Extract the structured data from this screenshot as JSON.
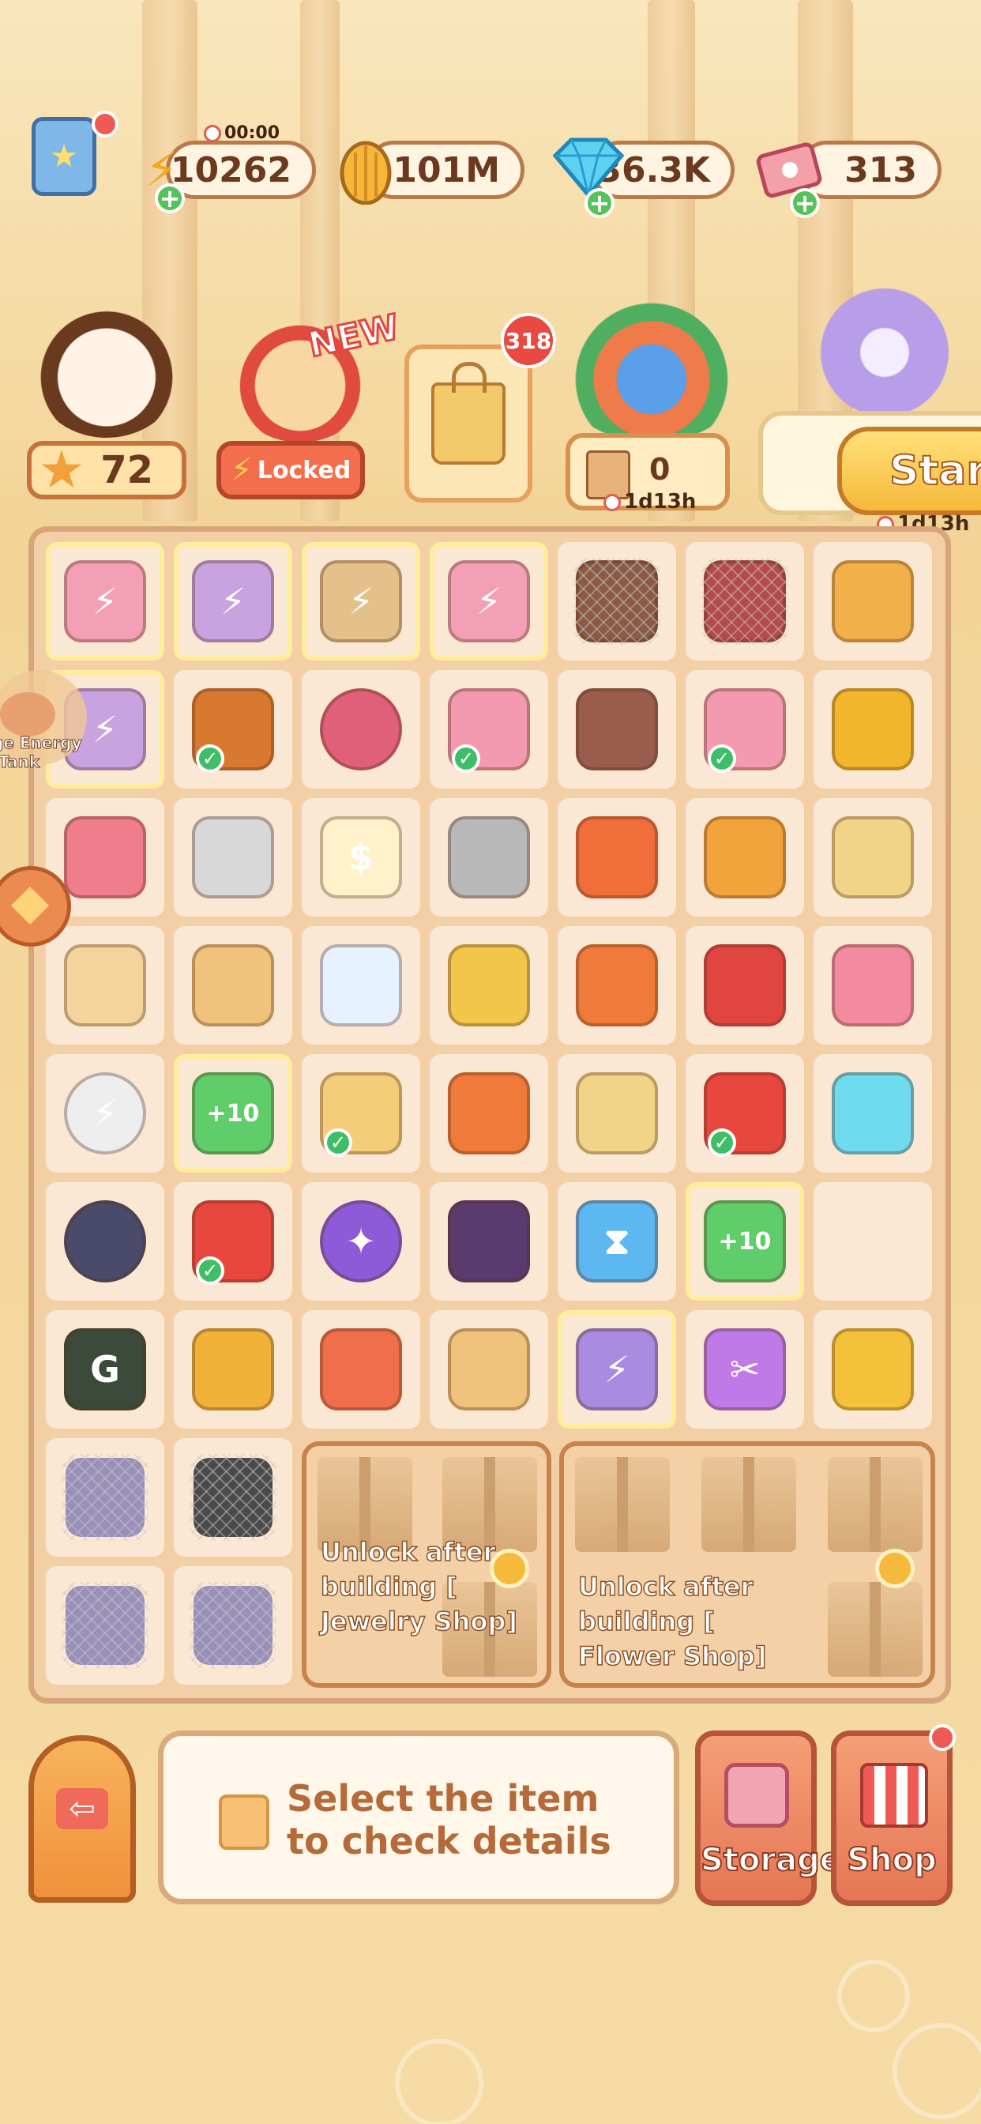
{
  "top_bar": {
    "energy": {
      "value": "10262",
      "timer": "00:00"
    },
    "seeds": {
      "value": "101M"
    },
    "gems": {
      "value": "36.3K"
    },
    "tickets": {
      "value": "313"
    }
  },
  "characters": {
    "star_count": "72",
    "locked_label": "Locked",
    "new_label": "NEW",
    "bag_badge": "318",
    "counter_value": "0",
    "counter_timer": "1d13h",
    "start_label": "Start",
    "start_timer": "1d13h"
  },
  "side_widget": {
    "line1": "ge Energy",
    "line2": "Tank"
  },
  "board": {
    "locked_zones": [
      {
        "text": "Unlock after building [ Jewelry Shop]"
      },
      {
        "text": "Unlock after building [ Flower Shop]"
      }
    ],
    "items": [
      [
        "energy-box-pink",
        "energy-cart",
        "energy-box-tan",
        "energy-box-pink",
        "bottle",
        "headphones",
        "fast-food"
      ],
      [
        "energy-cart",
        "chicken-leg",
        "coin-bag",
        "carousel",
        "sunflower-seeds",
        "carousel",
        "gold-ring"
      ],
      [
        "pet-crate",
        "spring",
        "receipt",
        "heater-coil",
        "snack-box",
        "pizza",
        "burrito"
      ],
      [
        "bread",
        "flour-sack",
        "milk-bottle",
        "cookie-bag",
        "gift-box",
        "canned-drink",
        "egg"
      ],
      [
        "energy-coin",
        "plus10-gem",
        "sandwich",
        "vending-set",
        "burrito",
        "chips",
        "diamond"
      ],
      [
        "wheel",
        "chips",
        "purple-button",
        "brush",
        "hex-gem-blue",
        "plus10-gem",
        "empty"
      ],
      [
        "game-controller",
        "seeds",
        "noodles",
        "flour-sack",
        "energy-box-purple",
        "scissors-gem",
        "fries"
      ]
    ]
  },
  "bottom": {
    "info_line1": "Select the item",
    "info_line2": "to check details",
    "storage_label": "Storage",
    "shop_label": "Shop"
  },
  "colors": {
    "accent": "#c7723b",
    "board_bg": "#f3cfa5",
    "cell_bg": "#fbe8d4",
    "button": "#e67656"
  }
}
